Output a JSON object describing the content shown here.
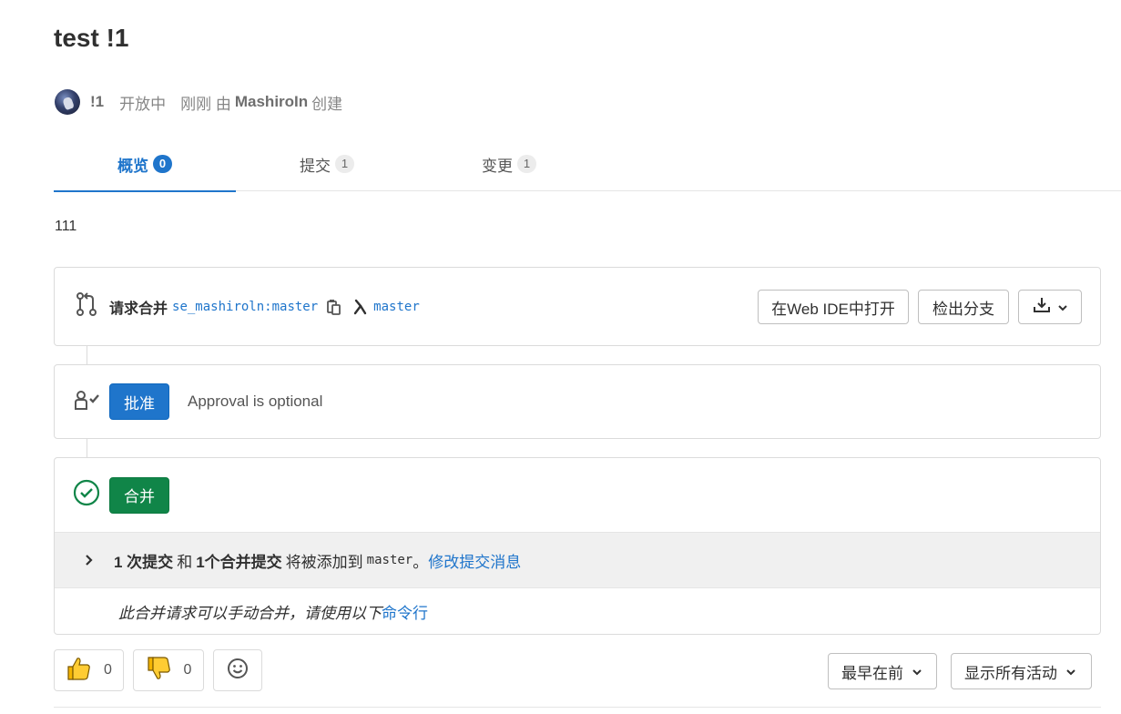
{
  "title": "test !1",
  "meta": {
    "mr_ref": "!1",
    "status": "开放中",
    "created_prefix": "刚刚 由",
    "author": "MashiroIn",
    "created_suffix": "创建"
  },
  "tabs": [
    {
      "label": "概览",
      "count": "0"
    },
    {
      "label": "提交",
      "count": "1"
    },
    {
      "label": "变更",
      "count": "1"
    }
  ],
  "description": "111",
  "merge_request": {
    "label": "请求合并",
    "source_branch": "se_mashiroln:master",
    "target_branch": "master",
    "buttons": {
      "open_ide": "在Web IDE中打开",
      "checkout": "检出分支"
    },
    "icons": {
      "merge_request": "merge-request-icon",
      "copy": "copy-icon",
      "into": "arrow-into-icon",
      "download": "download-icon",
      "chevron": "chevron-down-icon"
    }
  },
  "approval": {
    "button": "批准",
    "text": "Approval is optional",
    "icon": "approval-user-icon"
  },
  "merge": {
    "button": "合并",
    "commit_count": "1 次提交",
    "and": "和",
    "merge_commit": "1个合并提交",
    "will_add": "将被添加到",
    "target": "master",
    "period": "。",
    "edit_link": "修改提交消息",
    "manual_text": "此合并请求可以手动合并，请使用以下",
    "cmd_link": "命令行"
  },
  "footer": {
    "thumbs_up_count": "0",
    "thumbs_down_count": "0",
    "sort_order": "最早在前",
    "activity_filter": "显示所有活动"
  },
  "colors": {
    "primary": "#1f75cb",
    "success": "#108548"
  }
}
